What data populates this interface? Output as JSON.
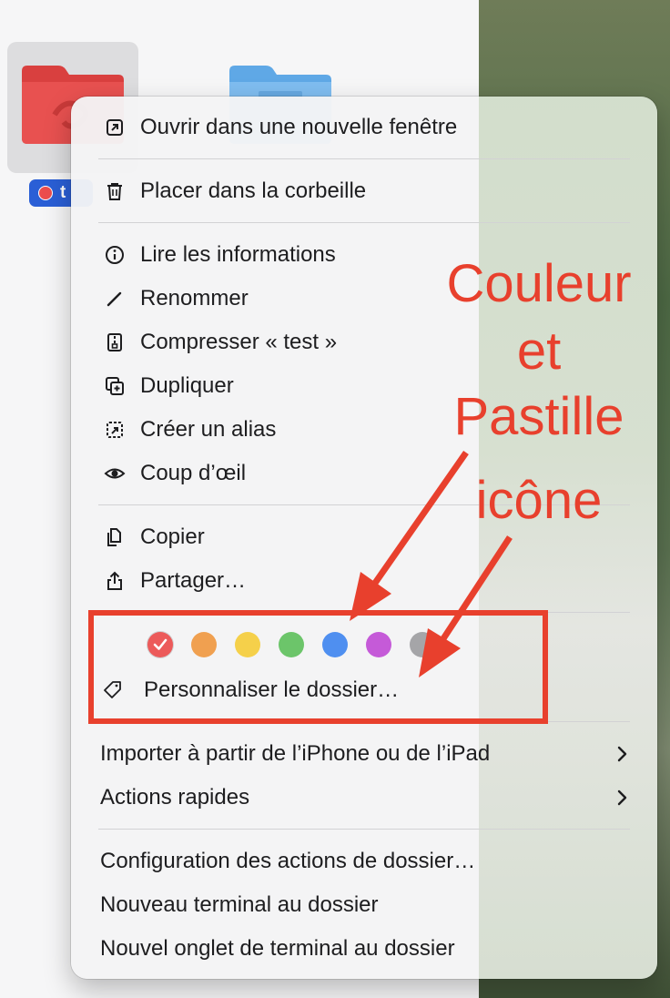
{
  "finder": {
    "selected_item_label": "t",
    "selected_tag_color": "#ec4d4d"
  },
  "menu": {
    "group1": [
      {
        "label": "Ouvrir dans une nouvelle fenêtre",
        "icon": "open-window-icon"
      },
      {
        "label": "Placer dans la corbeille",
        "icon": "trash-icon"
      }
    ],
    "group2": [
      {
        "label": "Lire les informations",
        "icon": "info-icon"
      },
      {
        "label": "Renommer",
        "icon": "pencil-icon"
      },
      {
        "label": "Compresser « test »",
        "icon": "archive-icon"
      },
      {
        "label": "Dupliquer",
        "icon": "duplicate-icon"
      },
      {
        "label": "Créer un alias",
        "icon": "alias-icon"
      },
      {
        "label": "Coup d’œil",
        "icon": "eye-icon"
      }
    ],
    "group3": [
      {
        "label": "Copier",
        "icon": "copy-icon"
      },
      {
        "label": "Partager…",
        "icon": "share-icon"
      }
    ],
    "tags": {
      "colors": [
        "#ec5a5a",
        "#f0a050",
        "#f5d04a",
        "#6cc56a",
        "#4f8ff0",
        "#c55ad8",
        "#a5a5a8"
      ],
      "selected_index": 0
    },
    "customize_label": "Personnaliser le dossier…",
    "group4": [
      {
        "label": "Importer à partir de l’iPhone ou de l’iPad",
        "submenu": true
      },
      {
        "label": "Actions rapides",
        "submenu": true
      }
    ],
    "group5": [
      {
        "label": "Configuration des actions de dossier…"
      },
      {
        "label": "Nouveau terminal au dossier"
      },
      {
        "label": "Nouvel onglet de terminal au dossier"
      }
    ]
  },
  "annotations": {
    "color": "#e8402d",
    "line1": "Couleur",
    "line2": "et",
    "line3": "Pastille",
    "line4": "icône"
  }
}
